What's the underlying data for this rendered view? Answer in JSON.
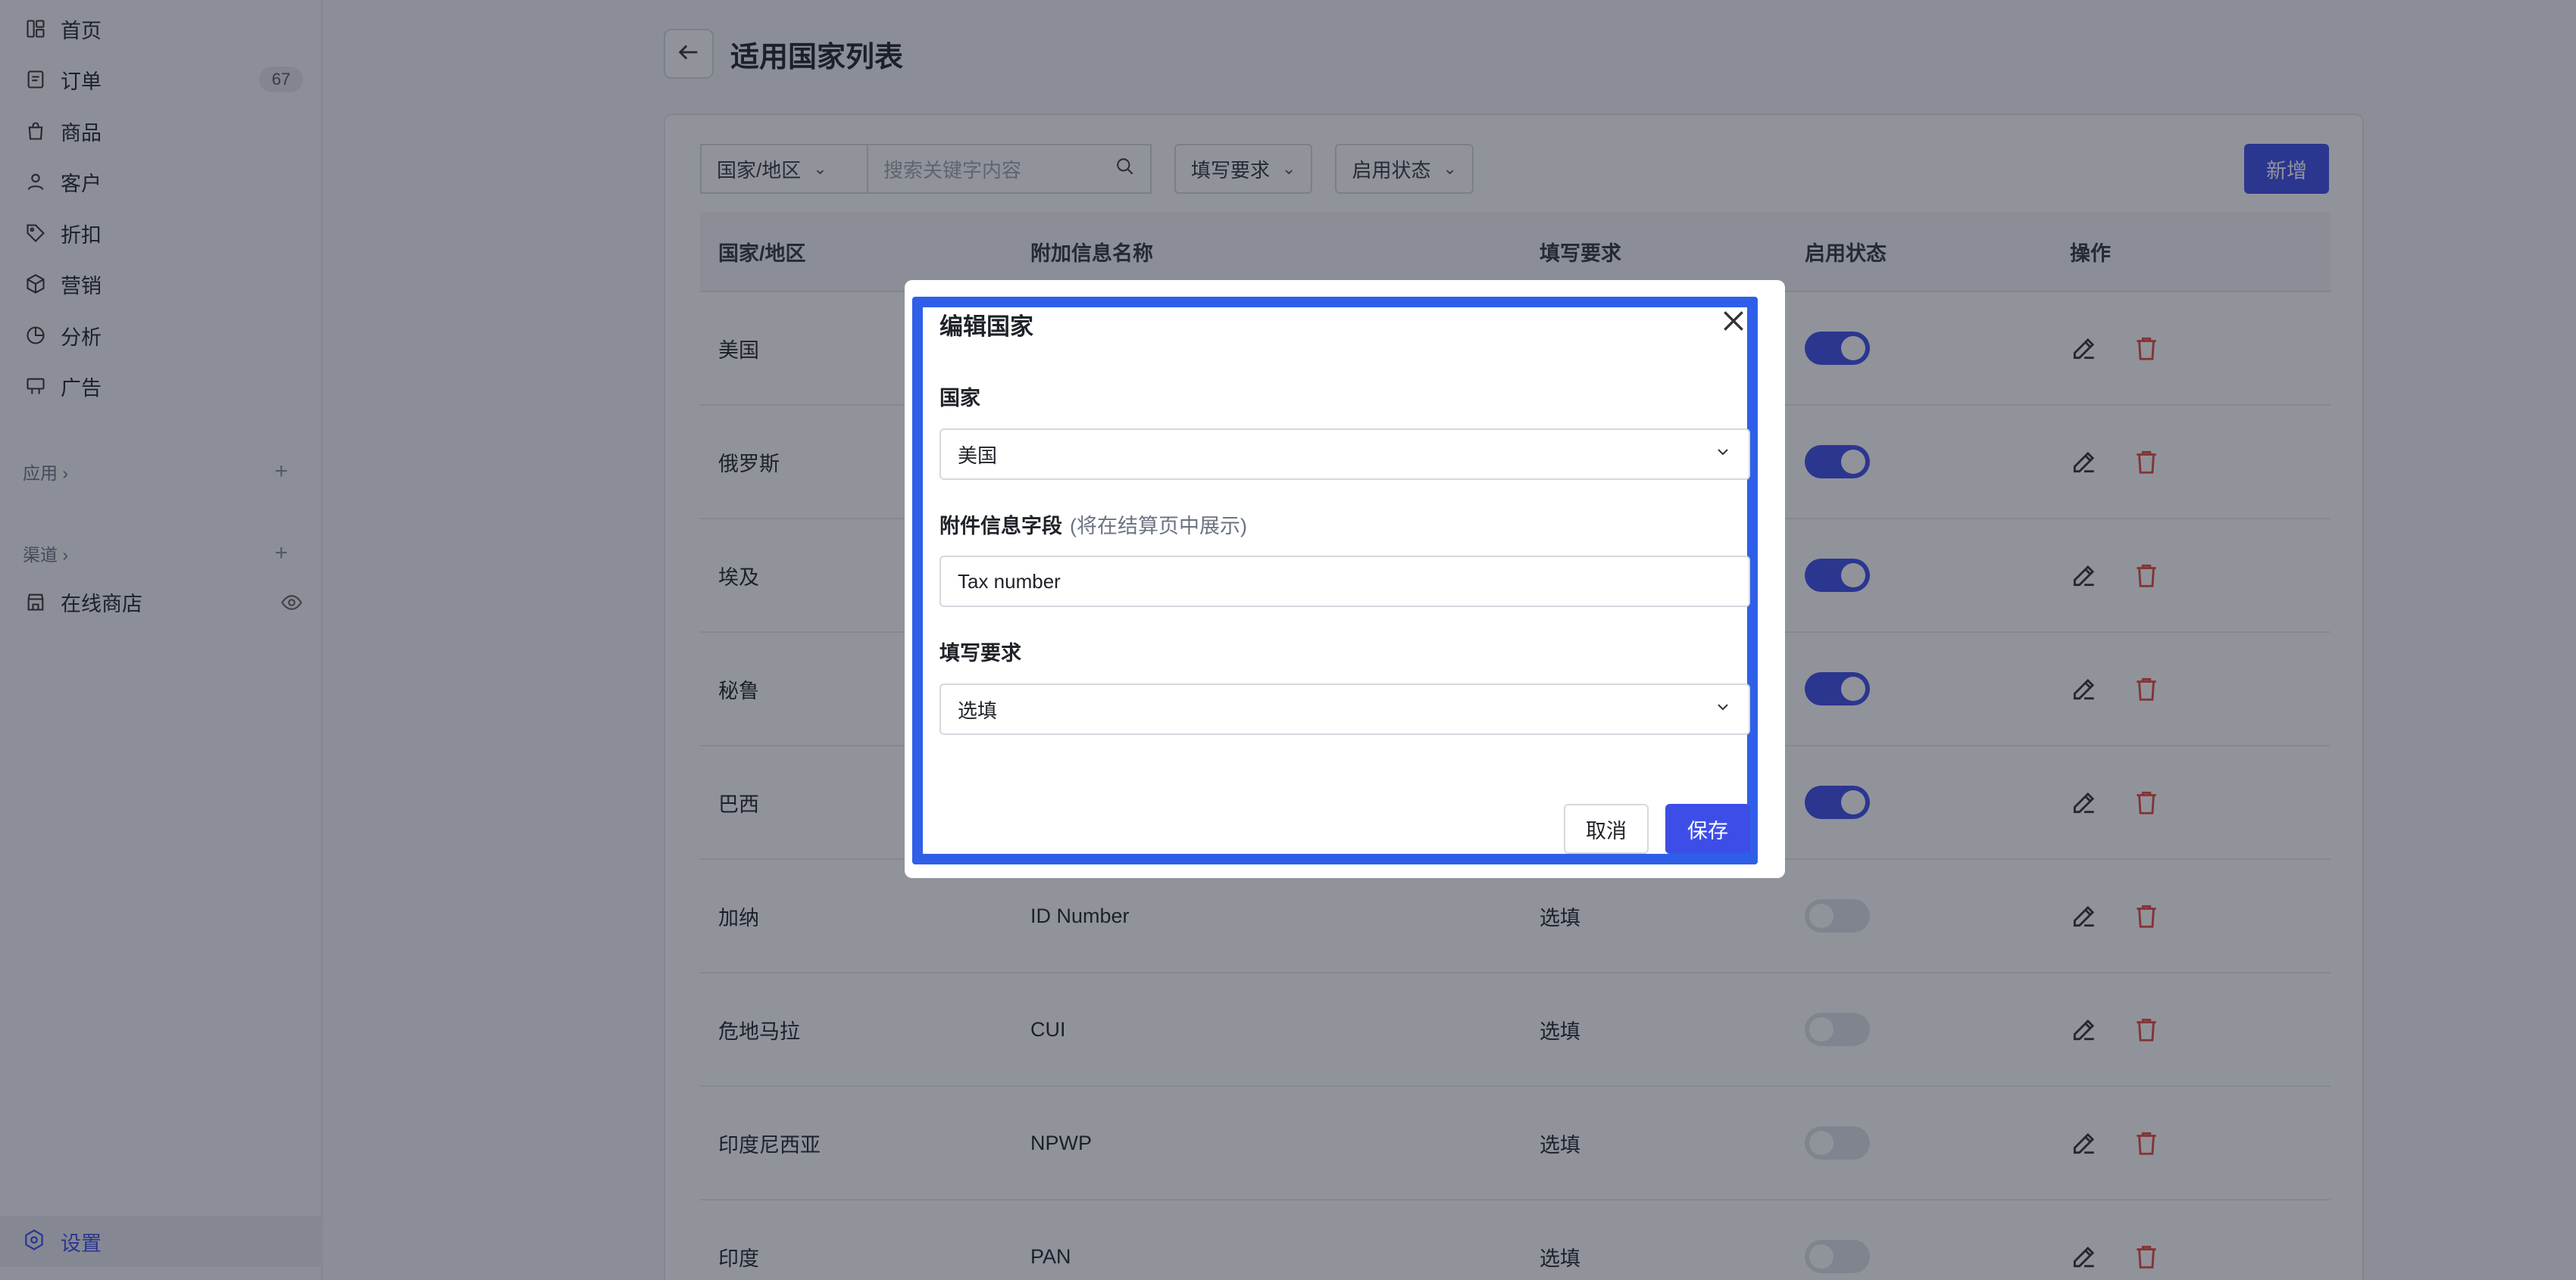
{
  "sidebar": {
    "items": [
      {
        "label": "首页",
        "icon": "home-icon"
      },
      {
        "label": "订单",
        "icon": "order-icon",
        "badge": "67"
      },
      {
        "label": "商品",
        "icon": "bag-icon"
      },
      {
        "label": "客户",
        "icon": "user-icon"
      },
      {
        "label": "折扣",
        "icon": "tag-icon"
      },
      {
        "label": "营销",
        "icon": "cube-icon"
      },
      {
        "label": "分析",
        "icon": "pie-chart-icon"
      },
      {
        "label": "广告",
        "icon": "billboard-icon"
      }
    ],
    "apps_label": "应用",
    "channels_label": "渠道",
    "online_store_label": "在线商店",
    "settings_label": "设置"
  },
  "header": {
    "title": "适用国家列表"
  },
  "toolbar": {
    "region_filter": "国家/地区",
    "search_placeholder": "搜索关键字内容",
    "requirement_filter": "填写要求",
    "status_filter": "启用状态",
    "add_label": "新增"
  },
  "table": {
    "columns": [
      "国家/地区",
      "附加信息名称",
      "填写要求",
      "启用状态",
      "操作"
    ],
    "rows": [
      {
        "country": "美国",
        "info": "",
        "req": "",
        "enabled": true
      },
      {
        "country": "俄罗斯",
        "info": "",
        "req": "",
        "enabled": true
      },
      {
        "country": "埃及",
        "info": "",
        "req": "",
        "enabled": true
      },
      {
        "country": "秘鲁",
        "info": "",
        "req": "",
        "enabled": true
      },
      {
        "country": "巴西",
        "info": "",
        "req": "",
        "enabled": true
      },
      {
        "country": "加纳",
        "info": "ID Number",
        "req": "选填",
        "enabled": false
      },
      {
        "country": "危地马拉",
        "info": "CUI",
        "req": "选填",
        "enabled": false
      },
      {
        "country": "印度尼西亚",
        "info": "NPWP",
        "req": "选填",
        "enabled": false
      },
      {
        "country": "印度",
        "info": "PAN",
        "req": "选填",
        "enabled": false
      }
    ]
  },
  "modal": {
    "title": "编辑国家",
    "country_label": "国家",
    "country_value": "美国",
    "field_label": "附件信息字段",
    "field_hint": "(将在结算页中展示)",
    "field_value": "Tax number",
    "req_label": "填写要求",
    "req_value": "选填",
    "cancel_label": "取消",
    "save_label": "保存"
  },
  "colors": {
    "accent": "#3d4ee8",
    "highlight": "#2f5fe8",
    "delete": "#e5483a"
  }
}
